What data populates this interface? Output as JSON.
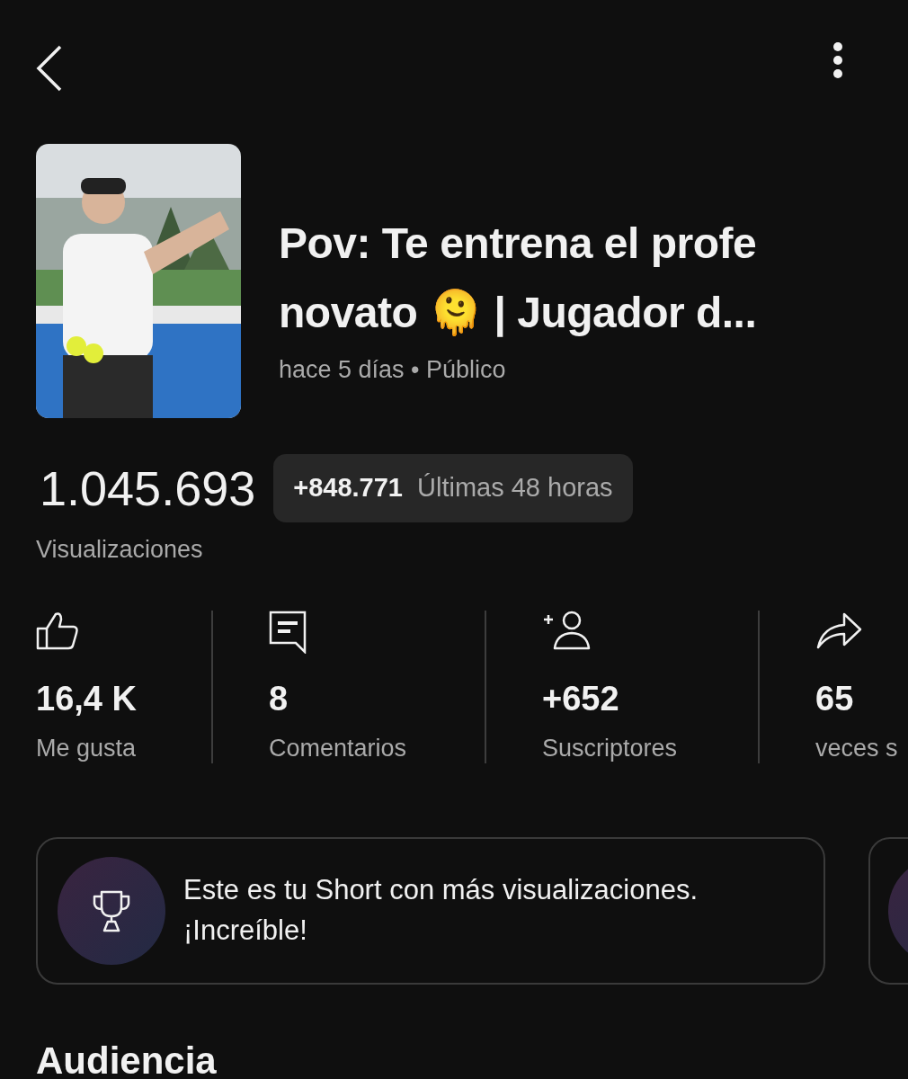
{
  "video": {
    "title": "Pov: Te entrena el profe novato 🫠 | Jugador d...",
    "meta": "hace 5 días • Público"
  },
  "views": {
    "value": "1.045.693",
    "delta": "+848.771",
    "period": "Últimas 48 horas",
    "label": "Visualizaciones"
  },
  "stats": [
    {
      "kind": "likes",
      "value": "16,4 K",
      "label": "Me gusta"
    },
    {
      "kind": "comments",
      "value": "8",
      "label": "Comentarios"
    },
    {
      "kind": "subscribers",
      "value": "+652",
      "label": "Suscriptores"
    },
    {
      "kind": "shares",
      "value": "65",
      "label": "veces s"
    }
  ],
  "insight": {
    "text": "Este es tu Short con más visualizaciones. ¡Increíble!"
  },
  "section": {
    "title": "Audiencia"
  }
}
